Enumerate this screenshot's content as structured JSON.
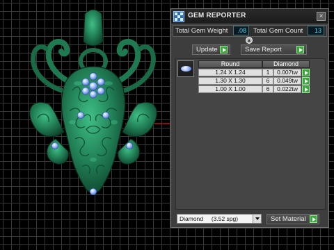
{
  "panel": {
    "title": "GEM REPORTER",
    "close_label": "×",
    "total_weight_label": "Total Gem Weight",
    "total_weight_value": ".08",
    "total_count_label": "Total Gem Count",
    "total_count_value": "13",
    "update_label": "Update",
    "save_report_label": "Save Report"
  },
  "table": {
    "columns": [
      "Round",
      "Diamond"
    ],
    "rows": [
      {
        "size": "1.24 X 1.24",
        "count": "1",
        "weight": "0.007tw"
      },
      {
        "size": "1.30 X 1.30",
        "count": "6",
        "weight": "0.049tw"
      },
      {
        "size": "1.00 X 1.00",
        "count": "6",
        "weight": "0.022tw"
      }
    ]
  },
  "material": {
    "selected": "Diamond     (3.52 spg)",
    "set_label": "Set Material"
  },
  "colors": {
    "model_green": "#1f7a52",
    "gem_blue": "#8fb6ff",
    "lcd_text": "#54d5f2",
    "go_green": "#3aa83a"
  },
  "icons": {
    "app": "gem-reporter-icon",
    "close": "close-icon",
    "go": "go-arrow-icon",
    "dropdown": "chevron-down-icon"
  }
}
